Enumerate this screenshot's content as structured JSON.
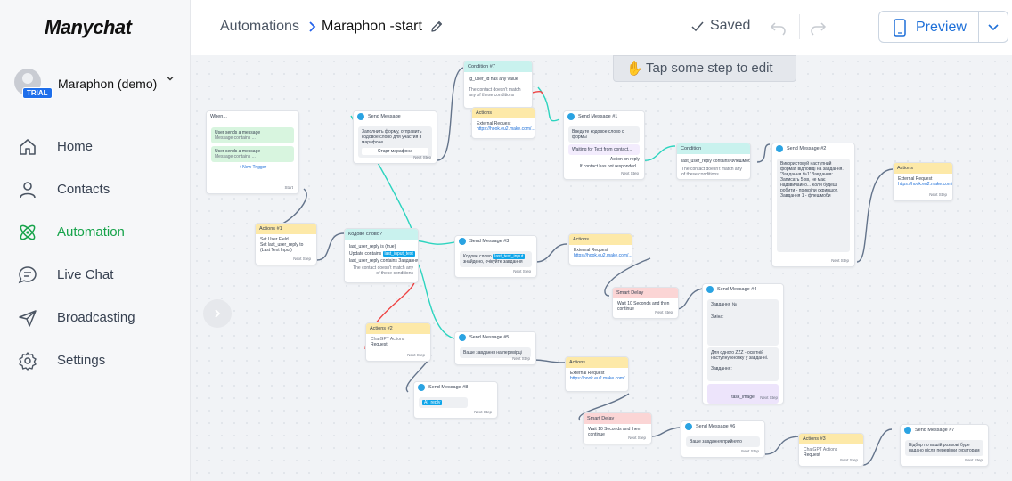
{
  "app": {
    "logo": "Manychat"
  },
  "account": {
    "name": "Maraphon (demo)",
    "badge": "TRIAL"
  },
  "nav": [
    {
      "label": "Home",
      "icon": "home-icon",
      "active": false
    },
    {
      "label": "Contacts",
      "icon": "user-icon",
      "active": false
    },
    {
      "label": "Automation",
      "icon": "atom-icon",
      "active": true
    },
    {
      "label": "Live Chat",
      "icon": "chat-icon",
      "active": false
    },
    {
      "label": "Broadcasting",
      "icon": "send-icon",
      "active": false
    },
    {
      "label": "Settings",
      "icon": "gear-icon",
      "active": false
    }
  ],
  "breadcrumb": {
    "parent": "Automations",
    "current": "Maraphon -start"
  },
  "toolbar": {
    "saved_label": "Saved",
    "preview_label": "Preview"
  },
  "canvas": {
    "hint": "Tap some step to edit"
  },
  "colors": {
    "accent": "#1d6fd8",
    "active_nav": "#16a34a",
    "condition": "#c9f2ee",
    "action": "#fde9a8",
    "delay": "#fbd5d5",
    "telegram": "#2aa3e2"
  },
  "nodes": {
    "trigger": {
      "title": "When...",
      "t1": "User sends a message",
      "t1s": "Message contains ...",
      "t2": "User sends a message",
      "t2s": "Message contains ...",
      "add": "+ New Trigger",
      "next": "Start"
    },
    "cond1": {
      "title": "Condition #7",
      "l1": "tg_user_id has any value",
      "l2": "The contact doesn't match any of these conditions"
    },
    "act_top": {
      "title": "Actions",
      "l1": "External Request",
      "l2": "https://hook.eu2.make.com/..."
    },
    "msg_start": {
      "sub": "Telegram",
      "title": "Send Message",
      "body": "Заполнить форму, отправить кодовое слово для участия в марафоне",
      "btn": "Старт марафона",
      "next": "Next Step"
    },
    "msg1": {
      "sub": "Telegram",
      "title": "Send Message #1",
      "body": "Введите кодовое слово с формы",
      "wait": "Waiting for Text from contact...",
      "r1": "Action on reply",
      "r2": "If contact has not responded...",
      "next": "Next Step"
    },
    "cond_code": {
      "title": "Кодове слово?",
      "l1": "last_user_reply is (true)",
      "l2": "Update contains",
      "chip": "last_input_text",
      "l3": "last_user_reply contains Завдання",
      "l4": "The contact doesn't match any of these conditions"
    },
    "act1": {
      "title": "Actions #1",
      "l1": "Set User Field",
      "l2": "Set last_user_reply to (Last Text Input)",
      "next": "Next Step"
    },
    "msg3": {
      "sub": "Telegram",
      "title": "Send Message #3",
      "body": "Кодове слово",
      "chip": "last_text_input",
      "body2": "знайдено, очікуйте завдання",
      "next": "Next Step"
    },
    "act_mid": {
      "title": "Actions",
      "l1": "External Request",
      "l2": "https://hook.eu2.make.com/..."
    },
    "cond2": {
      "title": "Condition",
      "l1": "last_user_reply contains Флешмоб",
      "l2": "The contact doesn't match any of these conditions",
      "next": "Next Step"
    },
    "msg2": {
      "sub": "Telegram",
      "title": "Send Message #2",
      "body": "Використовуй наступний формат відповіді на завдання. 'Завдання №1' Завдання: Записать 5 хв, не має надзвичайно... Коли будеш робити - прикріпи скриншот. Завдання 1 - флешмоби",
      "next": "Next Step"
    },
    "act_right": {
      "title": "Actions",
      "l1": "External Request",
      "l2": "https://hook.eu2.make.com/...",
      "next": "Next Step"
    },
    "delay1": {
      "title": "Smart Delay",
      "l1": "Wait 10 Seconds and then continue",
      "next": "Next Step"
    },
    "msg4": {
      "sub": "Telegram",
      "title": "Send Message #4",
      "l1": "Завдання №",
      "l2": "Зміна:",
      "l3": "Для одного ZZZ - освітній наступну кнопку у завданні.",
      "l4": "Завдання:",
      "img": "task_image",
      "next": "Next Step"
    },
    "act2": {
      "title": "Actions #2",
      "l1": "ChatGPT Actions",
      "l2": "Request",
      "next": "Next Step"
    },
    "msg5": {
      "sub": "Telegram",
      "title": "Send Message #5",
      "body": "Ваше завдання на перевірці",
      "next": "Next Step"
    },
    "act_low": {
      "title": "Actions",
      "l1": "External Request",
      "l2": "https://hook.eu2.make.com/..."
    },
    "msg8": {
      "sub": "Telegram",
      "title": "Send Message #8",
      "chip": "AI_reply",
      "next": "Next Step"
    },
    "delay2": {
      "title": "Smart Delay",
      "l1": "Wait 10 Seconds and then continue",
      "next": "Next Step"
    },
    "msg6": {
      "sub": "Telegram",
      "title": "Send Message #6",
      "body": "Ваше завдання прийнято",
      "next": "Next Step"
    },
    "act3": {
      "title": "Actions #3",
      "l1": "ChatGPT Actions",
      "l2": "Request",
      "next": "Next Step"
    },
    "msg7": {
      "sub": "Telegram",
      "title": "Send Message #7",
      "body": "Відбир по вашій розмові буде надано після перевірки кураторам",
      "next": "Next Step"
    }
  }
}
